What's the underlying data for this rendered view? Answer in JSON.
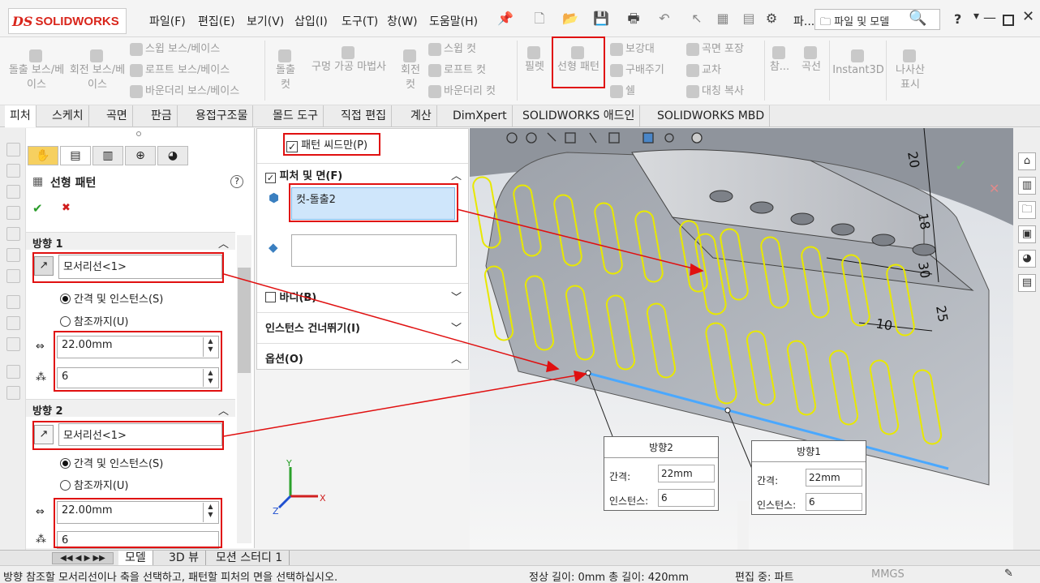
{
  "app": {
    "logo_ds": "DS",
    "logo_text": "SOLIDWORKS"
  },
  "menu": [
    "파일(F)",
    "편집(E)",
    "보기(V)",
    "삽입(I)",
    "도구(T)",
    "창(W)",
    "도움말(H)"
  ],
  "titlebar": {
    "truncated_label": "파...",
    "search_placeholder": "파일 및 모델",
    "help": "?"
  },
  "commands": {
    "extrude_boss": "돌출 보스/베이스",
    "revolve_boss": "회전 보스/베이스",
    "sweep_boss": "스윕 보스/베이스",
    "loft_boss": "로프트 보스/베이스",
    "boundary_boss": "바운더리 보스/베이스",
    "extrude_cut": "돌출 컷",
    "hole_wizard": "구멍 가공 마법사",
    "revolve_cut": "회전 컷",
    "sweep_cut": "스윕 컷",
    "loft_cut": "로프트 컷",
    "boundary_cut": "바운더리 컷",
    "fillet": "필렛",
    "linear_pattern": "선형 패턴",
    "rib": "보강대",
    "draft": "구배주기",
    "shell": "쉘",
    "wrap": "곡면 포장",
    "intersect": "교차",
    "mirror": "대칭 복사",
    "ref_geom": "참...",
    "curves": "곡선",
    "instant3d": "Instant3D",
    "helix": "나사산 표시"
  },
  "tabs": [
    "피처",
    "스케치",
    "곡면",
    "판금",
    "용접구조물",
    "몰드 도구",
    "직접 편집",
    "계산",
    "DimXpert",
    "SOLIDWORKS 애드인",
    "SOLIDWORKS MBD"
  ],
  "property_manager": {
    "title": "선형 패턴",
    "help": "?",
    "ok": "✔",
    "cancel": "✖",
    "direction1": {
      "header": "방향 1",
      "edge": "모서리선<1>",
      "opt_spacing": "간격 및 인스턴스(S)",
      "opt_upto": "참조까지(U)",
      "spacing": "22.00mm",
      "instances": "6"
    },
    "direction2": {
      "header": "방향 2",
      "edge": "모서리선<1>",
      "opt_spacing": "간격 및 인스턴스(S)",
      "opt_upto": "참조까지(U)",
      "spacing": "22.00mm",
      "instances": "6"
    }
  },
  "feature_panel": {
    "pattern_seed_only": "패턴 씨드만(P)",
    "features_faces": "피처 및 면(F)",
    "feature_item": "컷-돌출2",
    "bodies": "바디(B)",
    "skip_instances": "인스턴스 건너뛰기(I)",
    "options": "옵션(O)"
  },
  "callouts": {
    "dir2": {
      "title": "방향2",
      "spacing_label": "간격:",
      "spacing": "22mm",
      "instances_label": "인스턴스:",
      "instances": "6"
    },
    "dir1": {
      "title": "방향1",
      "spacing_label": "간격:",
      "spacing": "22mm",
      "instances_label": "인스턴스:",
      "instances": "6"
    }
  },
  "dimensions": [
    "20",
    "18",
    "30",
    "10",
    "25"
  ],
  "bottom_tabs": [
    "모델",
    "3D 뷰",
    "모션 스터디 1"
  ],
  "status": {
    "message": "방향 참조할 모서리선이나 축을 선택하고, 패턴할 피처의 면을 선택하십시오.",
    "length": "정상 길이: 0mm 총 길이: 420mm",
    "mode": "편집 중: 파트",
    "units": "MMGS"
  },
  "colors": {
    "accent_red": "#e01010",
    "highlight_yellow": "#e8e800",
    "selection_blue": "#4aa8ff"
  }
}
